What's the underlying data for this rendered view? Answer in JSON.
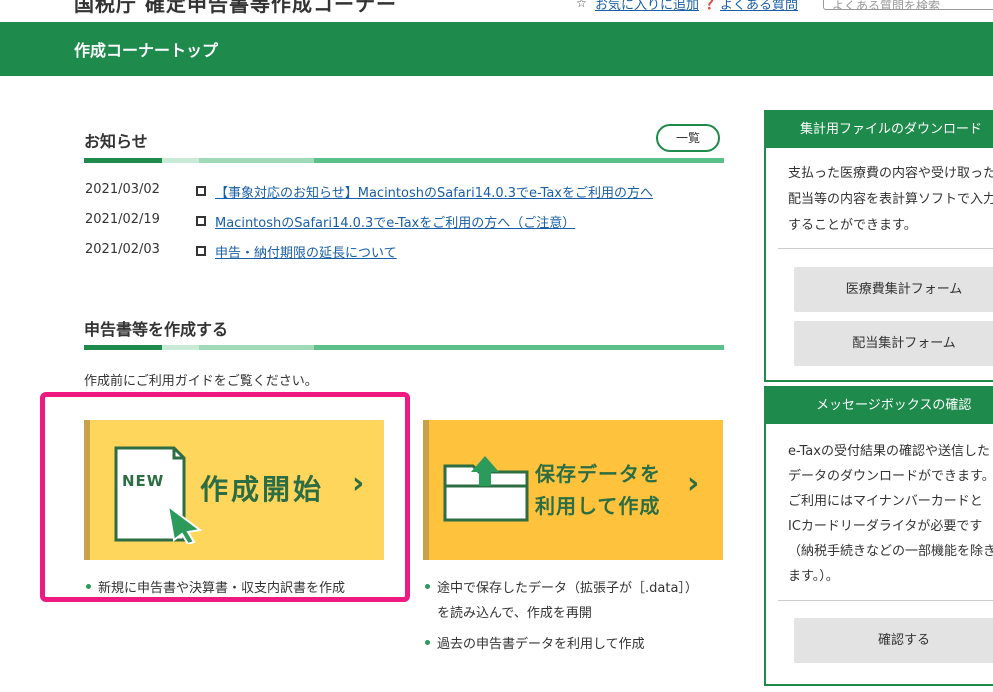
{
  "header": {
    "site_title": "国税庁 確定申告書等作成コーナー",
    "links": [
      {
        "icon": "star-icon",
        "label": "お気に入りに追加"
      },
      {
        "icon": "help-icon",
        "label": "よくある質問"
      }
    ],
    "search_placeholder": "よくある質問を検索"
  },
  "nav": {
    "breadcrumb": "作成コーナートップ"
  },
  "news": {
    "title": "お知らせ",
    "more_label": "一覧",
    "items": [
      {
        "date": "2021/03/02",
        "text": "【事象対応のお知らせ】MacintoshのSafari14.0.3でe-Taxをご利用の方へ"
      },
      {
        "date": "2021/02/19",
        "text": "MacintoshのSafari14.0.3でe-Taxをご利用の方へ（ご注意）"
      },
      {
        "date": "2021/02/03",
        "text": "申告・納付期限の延長について"
      }
    ]
  },
  "create": {
    "title": "申告書等を作成する",
    "guide_text": "作成前にご利用ガイドをご覧ください。",
    "start_card": {
      "icon": "new-document-icon",
      "badge": "NEW",
      "label": "作成開始",
      "bullets": [
        "新規に申告書や決算書・収支内訳書を作成"
      ]
    },
    "resume_card": {
      "icon": "folder-upload-icon",
      "label_line1": "保存データを",
      "label_line2": "利用して作成",
      "bullets": [
        "途中で保存したデータ（拡張子が［.data］）",
        "を読み込んで、作成を再開",
        "過去の申告書データを利用して作成"
      ]
    }
  },
  "sidebar": {
    "download": {
      "title": "集計用ファイルのダウンロード",
      "text_lines": [
        "支払った医療費の内容や受け取った",
        "配当等の内容を表計算ソフトで入力",
        "することができます。"
      ],
      "buttons": [
        "医療費集計フォーム",
        "配当集計フォーム"
      ]
    },
    "messagebox": {
      "title": "メッセージボックスの確認",
      "text_lines": [
        "e-Taxの受付結果の確認や送信した",
        "データのダウンロードができます。",
        "ご利用にはマイナンバーカードと",
        "ICカードリーダライタが必要です",
        "（納税手続きなどの一部機能を除き",
        "ます。）。"
      ],
      "button": "確認する"
    }
  },
  "colors": {
    "brand_green": "#1e8a4c",
    "highlight": "#ee1a82",
    "card_yellow": "#ffd65c",
    "card_orange": "#ffc23d"
  }
}
